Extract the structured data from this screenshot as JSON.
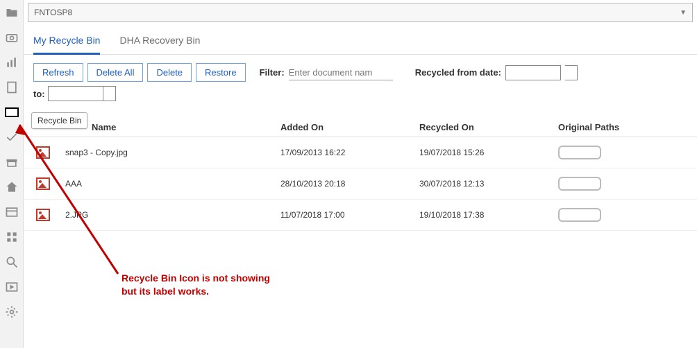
{
  "pathbar": {
    "text": "FNTOSP8"
  },
  "tabs": [
    {
      "label": "My Recycle Bin",
      "active": true
    },
    {
      "label": "DHA Recovery Bin",
      "active": false
    }
  ],
  "toolbar": {
    "refresh": "Refresh",
    "deleteAll": "Delete All",
    "delete": "Delete",
    "restore": "Restore",
    "filter_label": "Filter:",
    "filter_placeholder": "Enter document nam",
    "recycled_from_label": "Recycled from date:",
    "to_label": "to:"
  },
  "tooltip": "Recycle Bin",
  "columns": {
    "name": "Name",
    "added": "Added On",
    "recycled": "Recycled On",
    "original": "Original Paths"
  },
  "rows": [
    {
      "name": "snap3 - Copy.jpg",
      "added": "17/09/2013 16:22",
      "recycled": "19/07/2018 15:26"
    },
    {
      "name": "AAA",
      "added": "28/10/2013 20:18",
      "recycled": "30/07/2018 12:13"
    },
    {
      "name": "2.JPG",
      "added": "11/07/2018 17:00",
      "recycled": "19/10/2018 17:38"
    }
  ],
  "annotation": {
    "line1": "Recycle Bin Icon is not showing",
    "line2": "but its label works."
  }
}
